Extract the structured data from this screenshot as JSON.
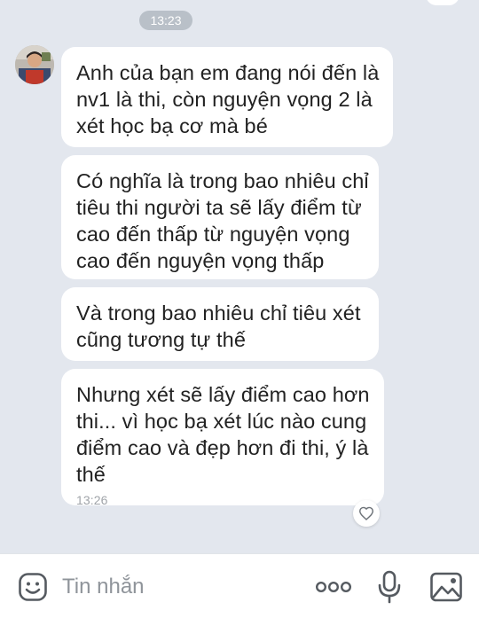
{
  "chat": {
    "date_separator_time": "13:23",
    "messages": [
      {
        "lines": [
          "Anh của bạn em đang nói đến là",
          "nv1 là thi, còn nguyện vọng 2 là",
          "xét học bạ cơ mà bé"
        ]
      },
      {
        "lines": [
          "Có nghĩa là trong bao nhiêu chỉ",
          "tiêu thi người ta sẽ lấy điểm từ",
          "cao đến thấp từ nguyện vọng",
          "cao đến nguyện vọng thấp"
        ]
      },
      {
        "lines": [
          "Và trong bao nhiêu chỉ tiêu xét",
          "cũng tương tự thế"
        ]
      },
      {
        "lines": [
          "Nhưng xét sẽ lấy điểm cao hơn",
          "thi... vì học bạ xét lúc nào cung",
          "điểm cao và đẹp hơn đi thi, ý là",
          "thế"
        ],
        "time": "13:26"
      }
    ]
  },
  "composer": {
    "placeholder": "Tin nhắn",
    "icons": {
      "sticker": "smiley-sticker-icon",
      "more": "more-options-icon",
      "mic": "microphone-icon",
      "image": "image-gallery-icon"
    }
  },
  "icons": {
    "like": "heart-outline-icon"
  },
  "colors": {
    "background": "#e3e7ee",
    "bubble": "#ffffff",
    "time_pill": "#b9c0c8",
    "text": "#222222",
    "muted": "#8f949a"
  }
}
